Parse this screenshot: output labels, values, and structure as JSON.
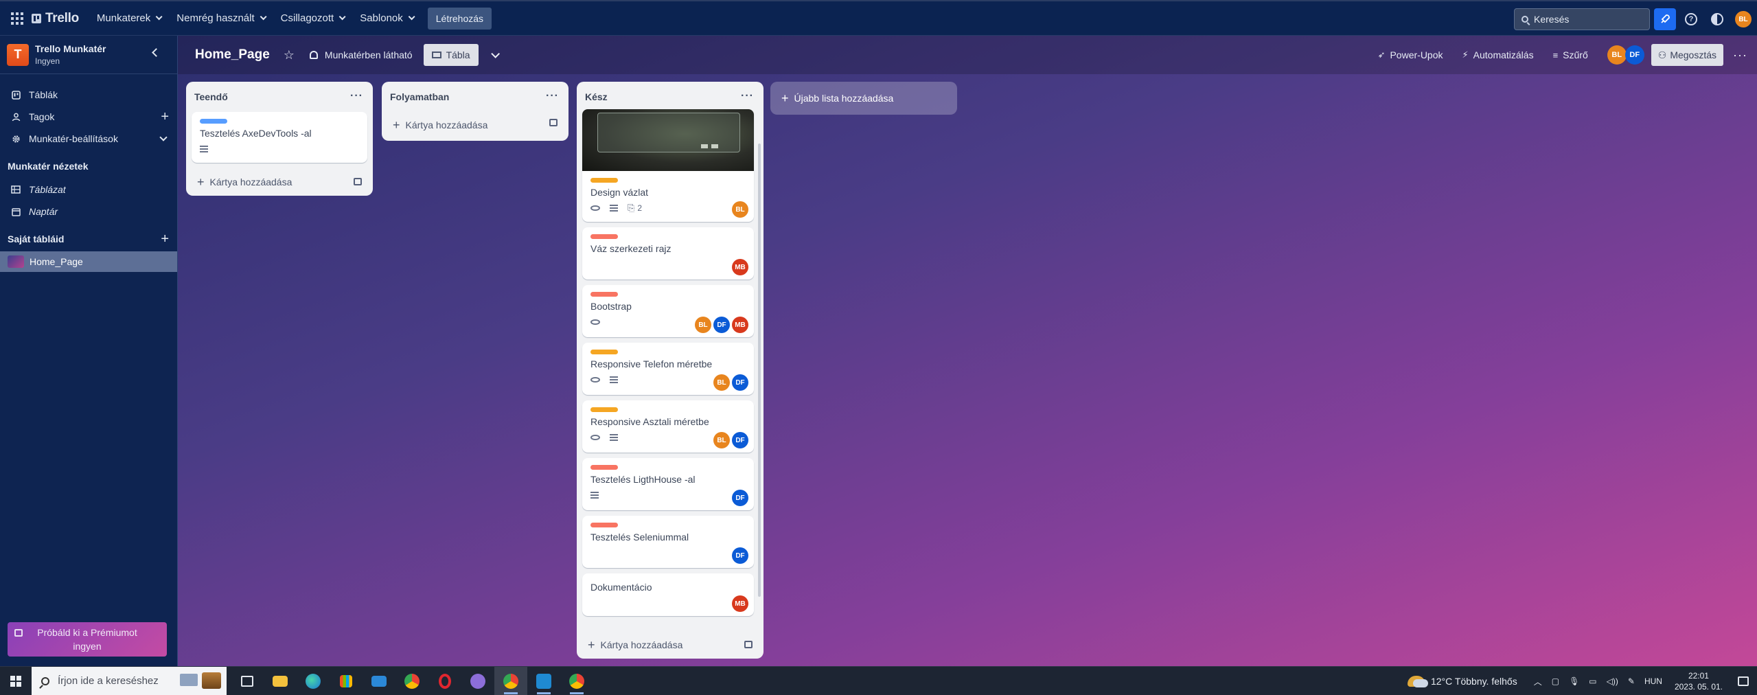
{
  "topbar": {
    "logo": "Trello",
    "nav": [
      "Munkaterek",
      "Nemrég használt",
      "Csillagozott",
      "Sablonok"
    ],
    "create": "Létrehozás",
    "search_placeholder": "Keresés",
    "user_initials": "BL"
  },
  "sidebar": {
    "workspace_initial": "T",
    "workspace_name": "Trello Munkatér",
    "workspace_plan": "Ingyen",
    "items": [
      {
        "label": "Táblák",
        "icon": "board-icon"
      },
      {
        "label": "Tagok",
        "icon": "person-icon"
      },
      {
        "label": "Munkatér-beállítások",
        "icon": "gear-icon"
      }
    ],
    "views_heading": "Munkatér nézetek",
    "views": [
      {
        "label": "Táblázat",
        "icon": "table-icon"
      },
      {
        "label": "Naptár",
        "icon": "calendar-icon"
      }
    ],
    "boards_heading": "Saját tábláid",
    "boards": [
      {
        "label": "Home_Page"
      }
    ],
    "premium": "Próbáld ki a Prémiumot ingyen"
  },
  "boardbar": {
    "title": "Home_Page",
    "visibility": "Munkatérben látható",
    "view": "Tábla",
    "powerups": "Power-Upok",
    "automation": "Automatizálás",
    "filter": "Szűrő",
    "members": [
      "BL",
      "DF"
    ],
    "share": "Megosztás"
  },
  "lists": [
    {
      "title": "Teendő",
      "cards": [
        {
          "title": "Tesztelés AxeDevTools -al",
          "label_color": "#579dff",
          "badges": {
            "watch": false,
            "desc": true,
            "attach": ""
          },
          "members": []
        }
      ],
      "add_card": "Kártya hozzáadása"
    },
    {
      "title": "Folyamatban",
      "cards": [],
      "add_card": "Kártya hozzáadása"
    },
    {
      "title": "Kész",
      "cards": [
        {
          "title": "Design vázlat",
          "label_color": "#f5a623",
          "cover": true,
          "badges": {
            "watch": true,
            "desc": true,
            "attach": "2"
          },
          "members": [
            "BL"
          ]
        },
        {
          "title": "Váz szerkezeti rajz",
          "label_color": "#f87462",
          "badges": {
            "watch": false,
            "desc": false,
            "attach": ""
          },
          "members": [
            "MB"
          ]
        },
        {
          "title": "Bootstrap",
          "label_color": "#f87462",
          "badges": {
            "watch": true,
            "desc": false,
            "attach": ""
          },
          "members": [
            "BL",
            "DF",
            "MB"
          ]
        },
        {
          "title": "Responsive Telefon méretbe",
          "label_color": "#f5a623",
          "badges": {
            "watch": true,
            "desc": true,
            "attach": ""
          },
          "members": [
            "BL",
            "DF"
          ]
        },
        {
          "title": "Responsive Asztali méretbe",
          "label_color": "#f5a623",
          "badges": {
            "watch": true,
            "desc": true,
            "attach": ""
          },
          "members": [
            "BL",
            "DF"
          ]
        },
        {
          "title": "Tesztelés LigthHouse -al",
          "label_color": "#f87462",
          "badges": {
            "watch": false,
            "desc": true,
            "attach": ""
          },
          "members": [
            "DF"
          ]
        },
        {
          "title": "Tesztelés Seleniummal",
          "label_color": "#f87462",
          "badges": {
            "watch": false,
            "desc": false,
            "attach": ""
          },
          "members": [
            "DF"
          ]
        },
        {
          "title": "Dokumentácio",
          "label_color": "",
          "badges": {
            "watch": false,
            "desc": false,
            "attach": ""
          },
          "members": [
            "MB"
          ]
        }
      ],
      "add_card": "Kártya hozzáadása"
    }
  ],
  "add_list": "Újabb lista hozzáadása",
  "taskbar": {
    "search_placeholder": "Írjon ide a kereséshez",
    "weather": "12°C  Többny. felhős",
    "language": "HUN",
    "time": "22:01",
    "date": "2023. 05. 01."
  }
}
